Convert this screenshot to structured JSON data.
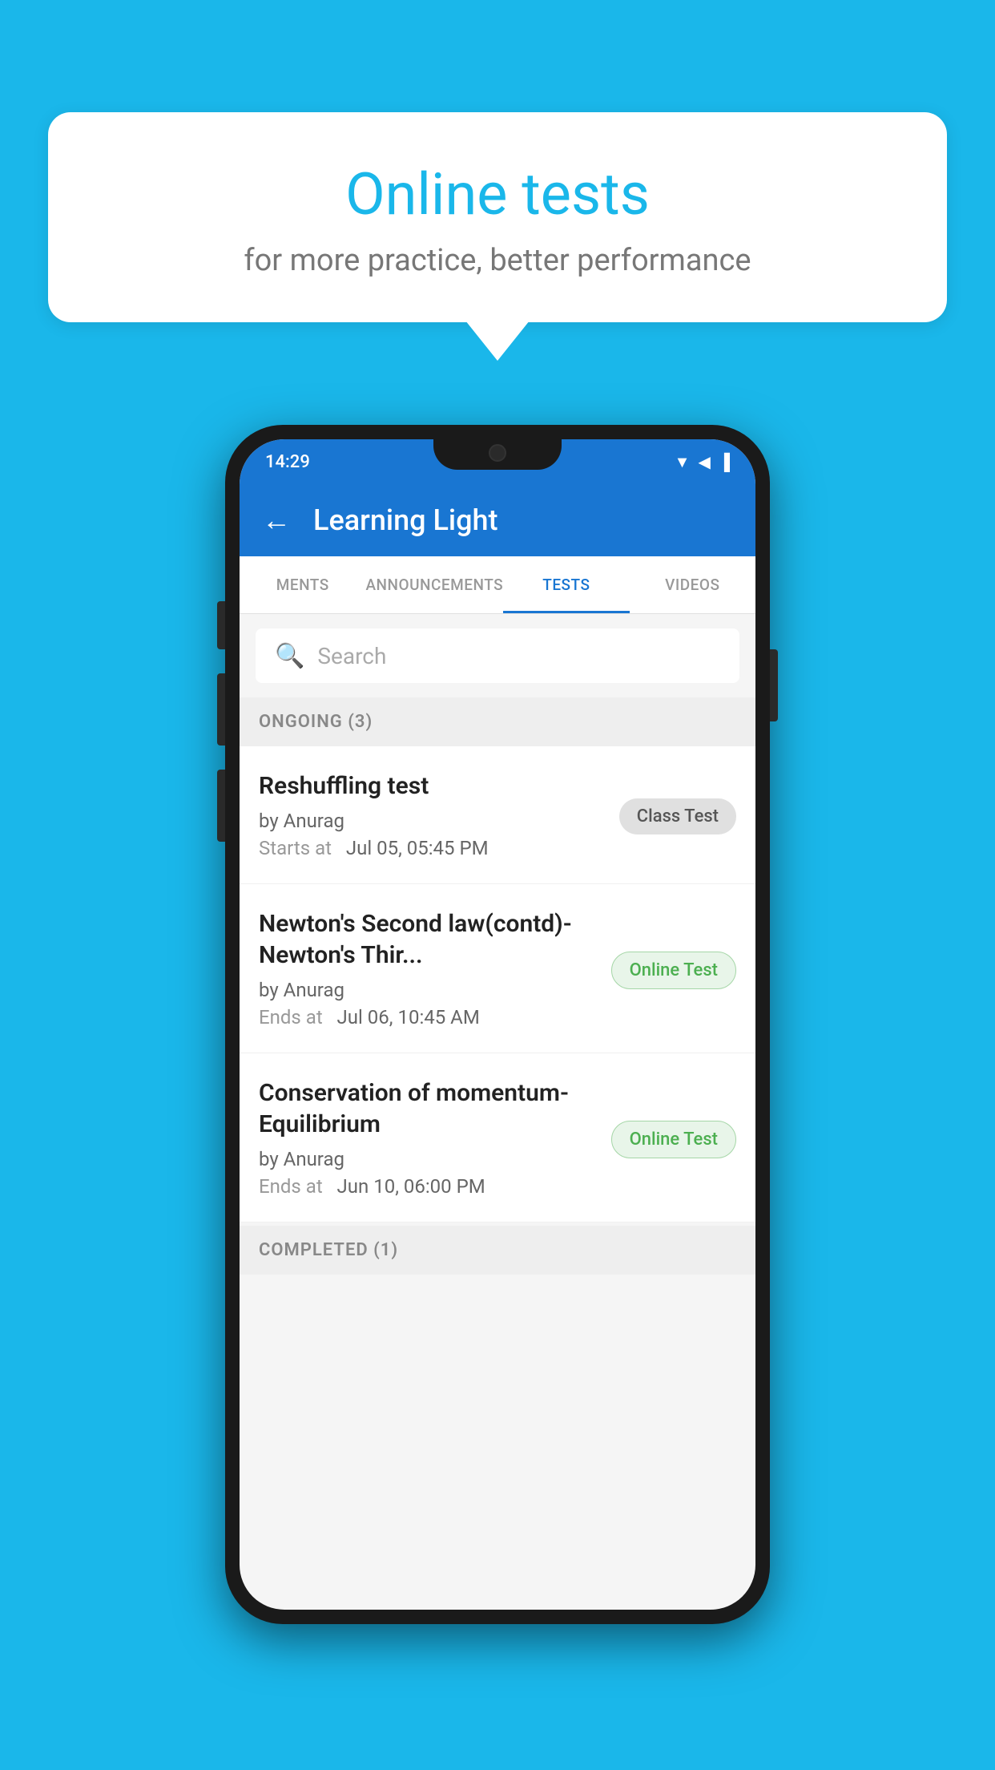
{
  "background": {
    "color": "#1ab7ea"
  },
  "speech_bubble": {
    "title": "Online tests",
    "subtitle": "for more practice, better performance"
  },
  "phone": {
    "status_bar": {
      "time": "14:29",
      "icons": "▼◀▐"
    },
    "app_bar": {
      "back_label": "←",
      "title": "Learning Light"
    },
    "tabs": [
      {
        "label": "MENTS",
        "active": false
      },
      {
        "label": "ANNOUNCEMENTS",
        "active": false
      },
      {
        "label": "TESTS",
        "active": true
      },
      {
        "label": "VIDEOS",
        "active": false
      }
    ],
    "search": {
      "placeholder": "Search"
    },
    "sections": [
      {
        "title": "ONGOING (3)",
        "tests": [
          {
            "name": "Reshuffling test",
            "author": "by Anurag",
            "time_label": "Starts at",
            "time_value": "Jul 05, 05:45 PM",
            "badge": "Class Test",
            "badge_type": "class"
          },
          {
            "name": "Newton's Second law(contd)-Newton's Thir...",
            "author": "by Anurag",
            "time_label": "Ends at",
            "time_value": "Jul 06, 10:45 AM",
            "badge": "Online Test",
            "badge_type": "online"
          },
          {
            "name": "Conservation of momentum-Equilibrium",
            "author": "by Anurag",
            "time_label": "Ends at",
            "time_value": "Jun 10, 06:00 PM",
            "badge": "Online Test",
            "badge_type": "online"
          }
        ]
      }
    ],
    "completed_section": {
      "title": "COMPLETED (1)"
    }
  }
}
